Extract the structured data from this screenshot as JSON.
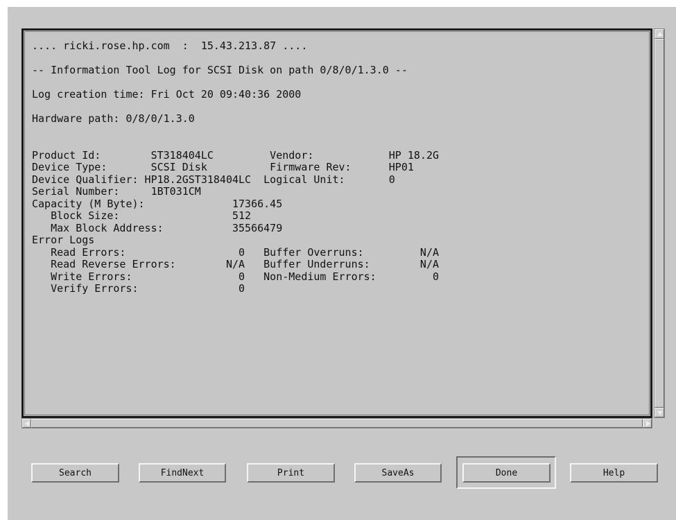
{
  "log": {
    "lines": [
      ".... ricki.rose.hp.com  :  15.43.213.87 ....",
      "",
      "-- Information Tool Log for SCSI Disk on path 0/8/0/1.3.0 --",
      "",
      "Log creation time: Fri Oct 20 09:40:36 2000",
      "",
      "Hardware path: 0/8/0/1.3.0",
      "",
      "",
      "Product Id:        ST318404LC         Vendor:            HP 18.2G",
      "Device Type:       SCSI Disk          Firmware Rev:      HP01",
      "Device Qualifier: HP18.2GST318404LC  Logical Unit:       0",
      "Serial Number:     1BT031CM",
      "Capacity (M Byte):              17366.45",
      "   Block Size:                  512",
      "   Max Block Address:           35566479",
      "Error Logs",
      "   Read Errors:                  0   Buffer Overruns:         N/A",
      "   Read Reverse Errors:        N/A   Buffer Underruns:        N/A",
      "   Write Errors:                 0   Non-Medium Errors:         0",
      "   Verify Errors:                0"
    ]
  },
  "buttons": {
    "search": "Search",
    "findnext": "FindNext",
    "print": "Print",
    "saveas": "SaveAs",
    "done": "Done",
    "help": "Help"
  },
  "icons": {
    "scroll_up": "arrow-up-icon",
    "scroll_down": "arrow-down-icon",
    "scroll_left": "arrow-left-icon",
    "scroll_right": "arrow-right-icon"
  },
  "colors": {
    "window_bg": "#c8c8c8",
    "frame_border": "#1a1a1a",
    "text": "#111111"
  }
}
